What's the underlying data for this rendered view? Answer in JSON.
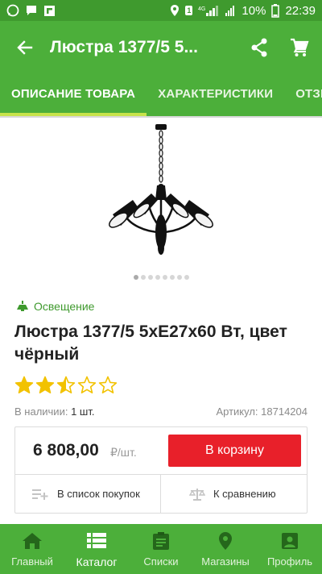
{
  "status_bar": {
    "network": "4G",
    "battery_percent": "10%",
    "time": "22:39",
    "sim_badge": "1"
  },
  "app_bar": {
    "title": "Люстра 1377/5 5..."
  },
  "tabs": [
    {
      "label": "ОПИСАНИЕ ТОВАРА",
      "active": true
    },
    {
      "label": "ХАРАКТЕРИСТИКИ",
      "active": false
    },
    {
      "label": "ОТЗЫ",
      "active": false
    }
  ],
  "gallery": {
    "total": 8,
    "current": 1
  },
  "product": {
    "category": "Освещение",
    "title": "Люстра 1377/5 5xE27x60 Вт, цвет чёрный",
    "rating": 2.5,
    "rating_max": 5,
    "stock_label": "В наличии:",
    "stock_value": "1 шт.",
    "sku": "Артикул: 18714204",
    "price": "6 808,00",
    "price_unit": "₽/шт.",
    "cart_button": "В корзину",
    "add_to_list": "В список покупок",
    "compare": "К сравнению"
  },
  "bottom_nav": [
    {
      "label": "Главный",
      "icon": "home-icon",
      "active": false
    },
    {
      "label": "Каталог",
      "icon": "catalog-icon",
      "active": true
    },
    {
      "label": "Списки",
      "icon": "clipboard-icon",
      "active": false
    },
    {
      "label": "Магазины",
      "icon": "location-pin-icon",
      "active": false
    },
    {
      "label": "Профиль",
      "icon": "profile-icon",
      "active": false
    }
  ],
  "colors": {
    "brand_green": "#4caf3a",
    "status_green": "#3f9a2e",
    "tab_indicator": "#c7e34a",
    "cart_red": "#e8202a",
    "star_yellow": "#f2c200"
  }
}
